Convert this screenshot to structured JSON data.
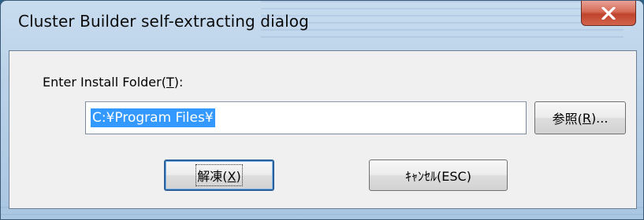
{
  "window": {
    "title": "Cluster Builder self-extracting dialog",
    "close_icon": "close-icon"
  },
  "form": {
    "prompt_prefix": "Enter Install Folder(",
    "prompt_accel": "T",
    "prompt_suffix": "):",
    "path_value": "C:¥Program Files¥"
  },
  "buttons": {
    "browse": {
      "prefix": "参照(",
      "accel": "R",
      "suffix": ")..."
    },
    "extract": {
      "prefix": "解凍(",
      "accel": "X",
      "suffix": ")"
    },
    "cancel": {
      "label": "ｷｬﾝｾﾙ(ESC)"
    }
  },
  "colors": {
    "selection": "#3399ff",
    "close_button": "#c0442c",
    "default_button_border": "#2a5f9a"
  }
}
